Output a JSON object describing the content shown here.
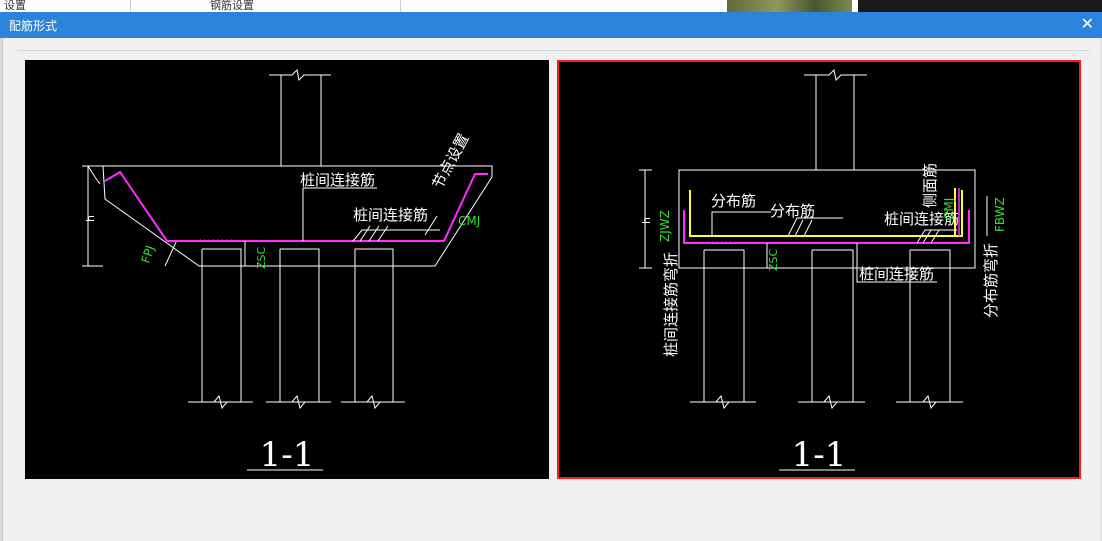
{
  "background_window": {
    "peek_left": "设置",
    "peek_mid": "钢筋设置"
  },
  "dialog": {
    "title": "配筋形式",
    "close_glyph": "✕"
  },
  "options": [
    {
      "id": "a",
      "selected": false,
      "section_label": "1-1",
      "labels": {
        "pile_rebar_top": "桩间连接筋",
        "pile_rebar_mid": "桩间连接筋",
        "node_setting": "节点设置",
        "cmj": "CMJ",
        "fpj": "FPJ",
        "zsc": "ZSC",
        "h": "h"
      }
    },
    {
      "id": "b",
      "selected": true,
      "section_label": "1-1",
      "labels": {
        "dist_rebar_1": "分布筋",
        "dist_rebar_2": "分布筋",
        "pile_rebar_top": "桩间连接筋",
        "pile_rebar_bottom": "桩间连接筋",
        "side_rebar": "侧面筋",
        "cmj": "CMJ",
        "zjwz": "ZJWZ",
        "fbwz": "FBWZ",
        "zsc": "ZSC",
        "h": "h",
        "pile_rebar_bend": "桩间连接筋弯折",
        "dist_rebar_bend": "分布筋弯折"
      }
    }
  ],
  "colors": {
    "titlebar": "#2b84d9",
    "selection": "#ff1a1a",
    "rebar_main": "#ff2bff",
    "rebar_dist": "#ffff33",
    "code_text": "#33dd33"
  }
}
